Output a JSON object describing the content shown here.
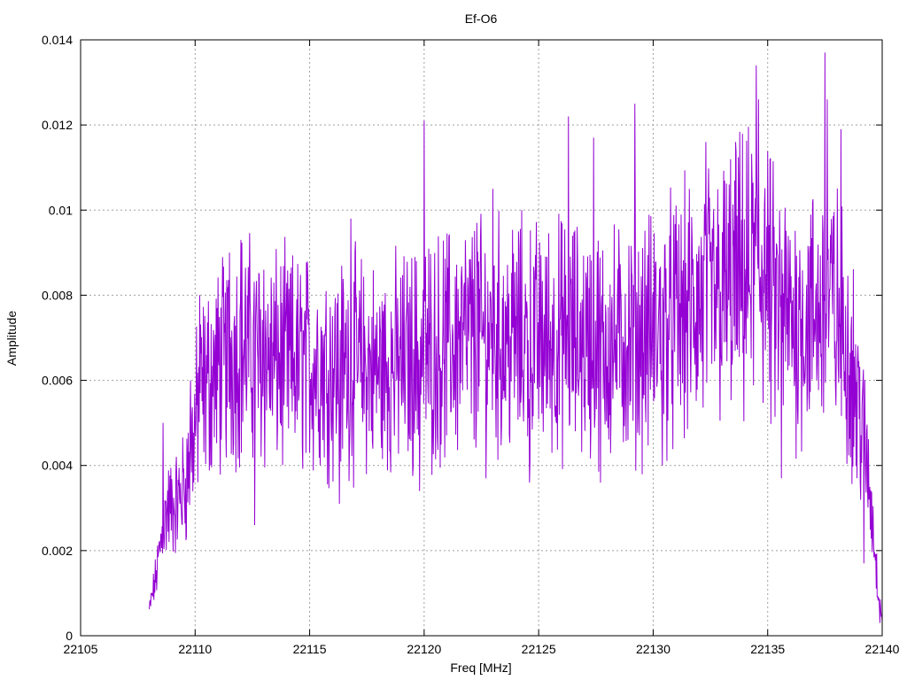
{
  "chart_data": {
    "type": "line",
    "title": "Ef-O6",
    "xlabel": "Freq [MHz]",
    "ylabel": "Amplitude",
    "xlim": [
      22105,
      22140
    ],
    "ylim": [
      0,
      0.014
    ],
    "xticks": [
      "22105",
      "22110",
      "22115",
      "22120",
      "22125",
      "22130",
      "22135",
      "22140"
    ],
    "yticks": [
      "0",
      "0.002",
      "0.004",
      "0.006",
      "0.008",
      "0.01",
      "0.012",
      "0.014"
    ],
    "grid": true,
    "legend": "none",
    "series": [
      {
        "color": "#9400d3",
        "x_start": 22108.0,
        "x_end": 22140.0,
        "note_envelope": [
          [
            22108.0,
            0.0006
          ],
          [
            22108.3,
            0.0014
          ],
          [
            22108.5,
            0.0022
          ],
          [
            22108.8,
            0.003
          ],
          [
            22109.0,
            0.003
          ],
          [
            22109.3,
            0.0032
          ],
          [
            22109.6,
            0.0036
          ],
          [
            22109.9,
            0.0046
          ],
          [
            22110.2,
            0.0056
          ],
          [
            22110.6,
            0.006
          ],
          [
            22111.0,
            0.0062
          ],
          [
            22111.5,
            0.0066
          ],
          [
            22112.0,
            0.0068
          ],
          [
            22113.0,
            0.0065
          ],
          [
            22114.0,
            0.0064
          ],
          [
            22115.0,
            0.0064
          ],
          [
            22116.0,
            0.0063
          ],
          [
            22117.0,
            0.0064
          ],
          [
            22118.0,
            0.0062
          ],
          [
            22119.0,
            0.0064
          ],
          [
            22120.0,
            0.0066
          ],
          [
            22121.0,
            0.0068
          ],
          [
            22122.0,
            0.007
          ],
          [
            22123.0,
            0.007
          ],
          [
            22124.0,
            0.007
          ],
          [
            22125.0,
            0.0069
          ],
          [
            22126.0,
            0.007
          ],
          [
            22127.0,
            0.0069
          ],
          [
            22128.0,
            0.0068
          ],
          [
            22129.0,
            0.0069
          ],
          [
            22130.0,
            0.0071
          ],
          [
            22131.0,
            0.0074
          ],
          [
            22132.0,
            0.0077
          ],
          [
            22133.0,
            0.008
          ],
          [
            22134.0,
            0.0083
          ],
          [
            22134.8,
            0.0088
          ],
          [
            22135.2,
            0.0078
          ],
          [
            22136.0,
            0.0074
          ],
          [
            22137.0,
            0.0075
          ],
          [
            22137.8,
            0.0078
          ],
          [
            22138.4,
            0.007
          ],
          [
            22138.9,
            0.0058
          ],
          [
            22139.3,
            0.0042
          ],
          [
            22139.6,
            0.0026
          ],
          [
            22139.8,
            0.0012
          ],
          [
            22140.0,
            0.0004
          ]
        ],
        "spikes": [
          [
            22108.6,
            0.005
          ],
          [
            22109.8,
            0.006
          ],
          [
            22110.2,
            0.008
          ],
          [
            22111.5,
            0.009
          ],
          [
            22112.0,
            0.0093
          ],
          [
            22112.6,
            0.0026
          ],
          [
            22113.0,
            0.0086
          ],
          [
            22116.8,
            0.0098
          ],
          [
            22116.3,
            0.0031
          ],
          [
            22119.8,
            0.0034
          ],
          [
            22120.0,
            0.0121
          ],
          [
            22122.3,
            0.0097
          ],
          [
            22123.0,
            0.0105
          ],
          [
            22124.6,
            0.0036
          ],
          [
            22126.3,
            0.0122
          ],
          [
            22127.4,
            0.0117
          ],
          [
            22127.7,
            0.0036
          ],
          [
            22129.2,
            0.0125
          ],
          [
            22130.4,
            0.004
          ],
          [
            22132.3,
            0.0116
          ],
          [
            22133.6,
            0.0116
          ],
          [
            22134.5,
            0.0134
          ],
          [
            22134.6,
            0.0126
          ],
          [
            22135.6,
            0.0037
          ],
          [
            22137.5,
            0.0137
          ],
          [
            22137.6,
            0.0126
          ],
          [
            22138.2,
            0.0119
          ],
          [
            22138.9,
            0.0037
          ],
          [
            22139.2,
            0.0017
          ],
          [
            22139.9,
            0.0003
          ]
        ]
      }
    ]
  }
}
